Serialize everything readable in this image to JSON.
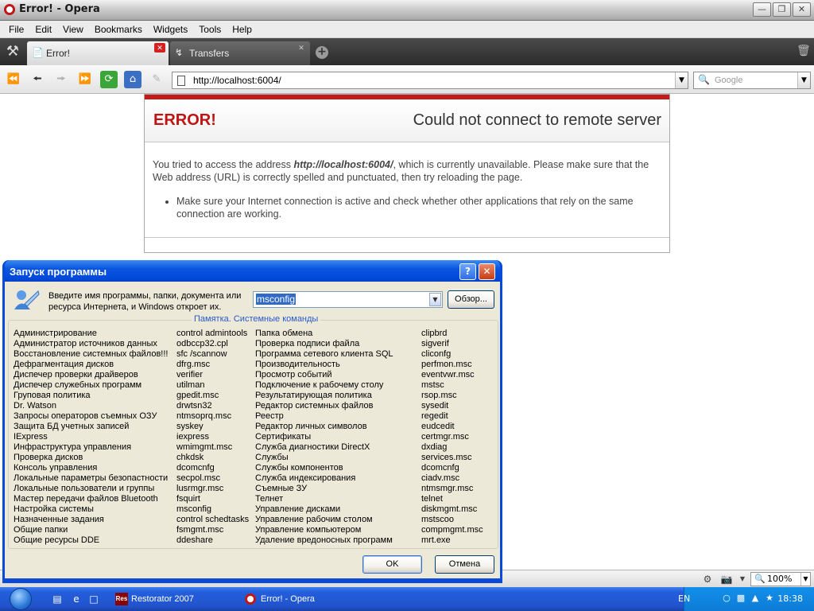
{
  "window": {
    "title": "Error! - Opera"
  },
  "menubar": [
    "File",
    "Edit",
    "View",
    "Bookmarks",
    "Widgets",
    "Tools",
    "Help"
  ],
  "tabs": [
    {
      "label": "Error!",
      "active": true
    },
    {
      "label": "Transfers",
      "active": false
    }
  ],
  "address_bar": {
    "url": "http://localhost:6004/"
  },
  "search": {
    "placeholder": "Google"
  },
  "error_page": {
    "heading": "ERROR!",
    "title": "Could not connect to remote server",
    "message_pre": "You tried to access the address ",
    "message_addr": "http://localhost:6004/",
    "message_post": ", which is currently unavailable. Please make sure that the Web address (URL) is correctly spelled and punctuated, then try reloading the page.",
    "bullet": "Make sure your Internet connection is active and check whether other applications that rely on the same connection are working."
  },
  "status": {
    "zoom": "100%"
  },
  "run_dialog": {
    "title": "Запуск программы",
    "prompt": "Введите имя программы, папки, документа или ресурса Интернета, и Windows откроет их.",
    "input_value": "msconfig",
    "browse_label": "Обзор...",
    "memo_title": "Памятка. Системные команды",
    "ok_label": "OK",
    "cancel_label": "Отмена",
    "col1": [
      "Администрирование",
      "Администратор источников данных",
      "Восстановление системных файлов!!!",
      "Дефрагментация дисков",
      "Диспечер проверки драйверов",
      "Диспечер служебных программ",
      "Груповая политика",
      "Dr. Watson",
      "Запросы операторов съемных ОЗУ",
      "Защита БД учетных записей",
      "IExpress",
      "Инфраструктура управления",
      "Проверка дисков",
      "Консоль управления",
      "Локальные параметры безопастности",
      "Локальные пользователи и группы",
      "Мастер передачи файлов Bluetooth",
      "Настройка системы",
      "Назначенные задания",
      "Общие папки",
      "Общие ресурсы DDE"
    ],
    "col2": [
      "control admintools",
      "odbccp32.cpl",
      "sfc /scannow",
      "dfrg.msc",
      "verifier",
      "utilman",
      "gpedit.msc",
      "drwtsn32",
      "ntmsoprq.msc",
      "syskey",
      "iexpress",
      "wmimgmt.msc",
      "chkdsk",
      "dcomcnfg",
      "secpol.msc",
      "lusrmgr.msc",
      "fsquirt",
      "msconfig",
      "control schedtasks",
      "fsmgmt.msc",
      "ddeshare"
    ],
    "col3": [
      "Папка обмена",
      "Проверка подписи файла",
      "Программа сетевого клиента SQL",
      "Производительность",
      "Просмотр событий",
      "Подключение к рабочему столу",
      "Результатирующая политика",
      "Редактор системных файлов",
      "Реестр",
      "Редактор личных символов",
      "Сертификаты",
      "Служба диагностики DirectX",
      "Службы",
      "Службы компонентов",
      "Служба индексирования",
      "Съемные ЗУ",
      "Телнет",
      "Управление дисками",
      "Управление рабочим столом",
      "Управление компьютером",
      "Удаление вредоносных программ"
    ],
    "col4": [
      "clipbrd",
      "sigverif",
      "cliconfg",
      "perfmon.msc",
      "eventvwr.msc",
      "mstsc",
      "rsop.msc",
      "sysedit",
      "regedit",
      "eudcedit",
      "certmgr.msc",
      "dxdiag",
      "services.msc",
      "dcomcnfg",
      "ciadv.msc",
      "ntmsmgr.msc",
      "telnet",
      "diskmgmt.msc",
      "mstscoo",
      "compmgmt.msc",
      "mrt.exe"
    ]
  },
  "taskbar": {
    "tasks": [
      {
        "label": "Restorator 2007",
        "icon": "Res"
      },
      {
        "label": "Error! - Opera"
      }
    ],
    "language": "EN",
    "clock": "18:38"
  }
}
